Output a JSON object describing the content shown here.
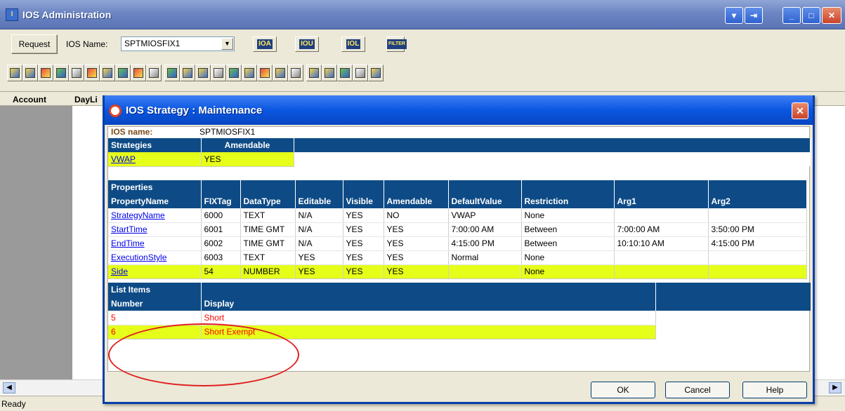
{
  "app": {
    "title": "IOS Administration",
    "icon_label": "I",
    "controls": [
      "▾",
      "⇥",
      "_",
      "□",
      "✕"
    ]
  },
  "request_bar": {
    "request_button": "Request",
    "ios_name_label": "IOS Name:",
    "ios_name_value": "SPTMIOSFIX1",
    "buttons": [
      "IOA",
      "IOU",
      "IOL",
      "FILTER"
    ]
  },
  "background_grid": {
    "columns": [
      "Account",
      "DayLi"
    ]
  },
  "status_bar": "Ready",
  "dialog": {
    "title": "IOS Strategy : Maintenance",
    "ios_name_label": "IOS name:",
    "ios_name_value": "SPTMIOSFIX1",
    "strategies": {
      "headers": [
        "Strategies",
        "Amendable"
      ],
      "rows": [
        [
          "VWAP",
          "YES"
        ]
      ]
    },
    "properties": {
      "caption": "Properties",
      "headers": [
        "PropertyName",
        "FIXTag",
        "DataType",
        "Editable",
        "Visible",
        "Amendable",
        "DefaultValue",
        "Restriction",
        "Arg1",
        "Arg2"
      ],
      "rows": [
        [
          "StrategyName",
          "6000",
          "TEXT",
          "N/A",
          "YES",
          "NO",
          "VWAP",
          "None",
          "",
          ""
        ],
        [
          "StartTime",
          "6001",
          "TIME GMT",
          "N/A",
          "YES",
          "YES",
          "7:00:00 AM",
          "Between",
          "7:00:00 AM",
          "3:50:00 PM"
        ],
        [
          "EndTime",
          "6002",
          "TIME GMT",
          "N/A",
          "YES",
          "YES",
          "4:15:00 PM",
          "Between",
          "10:10:10 AM",
          "4:15:00 PM"
        ],
        [
          "ExecutionStyle",
          "6003",
          "TEXT",
          "YES",
          "YES",
          "YES",
          "Normal",
          "None",
          "",
          ""
        ],
        [
          "Side",
          "54",
          "NUMBER",
          "YES",
          "YES",
          "YES",
          "",
          "None",
          "",
          ""
        ]
      ]
    },
    "list_items": {
      "caption": "List Items",
      "headers": [
        "Number",
        "Display"
      ],
      "rows": [
        [
          "5",
          "Short"
        ],
        [
          "6",
          "Short Exempt"
        ]
      ]
    },
    "buttons": {
      "ok": "OK",
      "cancel": "Cancel",
      "help": "Help"
    }
  }
}
